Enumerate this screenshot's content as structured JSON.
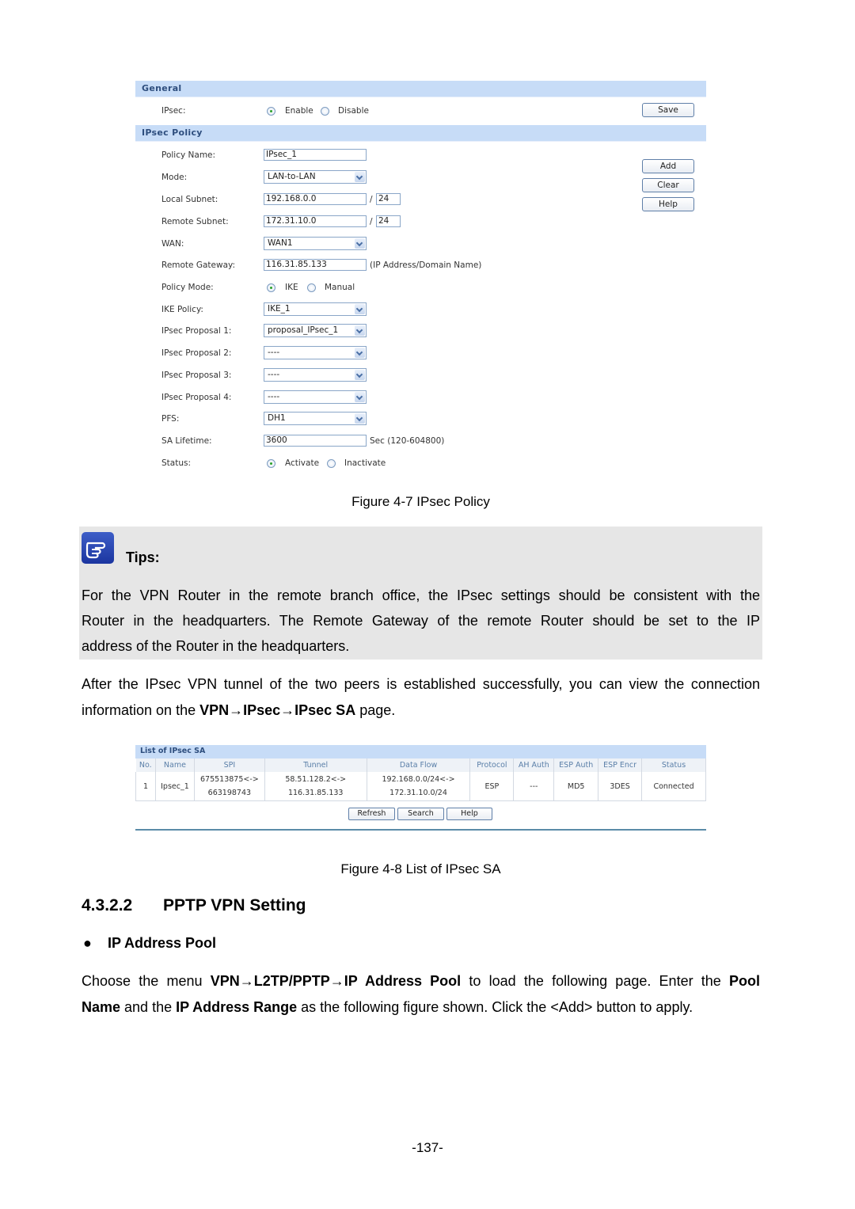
{
  "figure1": {
    "general_header": "General",
    "ipsec_label": "IPsec:",
    "ipsec_options": [
      "Enable",
      "Disable"
    ],
    "ipsec_selected": "Enable",
    "save_label": "Save",
    "policy_header": "IPsec Policy",
    "add_label": "Add",
    "clear_label": "Clear",
    "help_label": "Help",
    "fields": {
      "policy_name": {
        "label": "Policy Name:",
        "value": "IPsec_1"
      },
      "mode": {
        "label": "Mode:",
        "value": "LAN-to-LAN"
      },
      "local_subnet": {
        "label": "Local Subnet:",
        "value": "192.168.0.0",
        "mask": "24"
      },
      "remote_subnet": {
        "label": "Remote Subnet:",
        "value": "172.31.10.0",
        "mask": "24"
      },
      "wan": {
        "label": "WAN:",
        "value": "WAN1"
      },
      "remote_gateway": {
        "label": "Remote Gateway:",
        "value": "116.31.85.133",
        "hint": "(IP Address/Domain Name)"
      },
      "policy_mode": {
        "label": "Policy Mode:",
        "options": [
          "IKE",
          "Manual"
        ],
        "selected": "IKE"
      },
      "ike_policy": {
        "label": "IKE Policy:",
        "value": "IKE_1"
      },
      "proposal1": {
        "label": "IPsec Proposal 1:",
        "value": "proposal_IPsec_1"
      },
      "proposal2": {
        "label": "IPsec Proposal 2:",
        "value": "----"
      },
      "proposal3": {
        "label": "IPsec Proposal 3:",
        "value": "----"
      },
      "proposal4": {
        "label": "IPsec Proposal 4:",
        "value": "----"
      },
      "pfs": {
        "label": "PFS:",
        "value": "DH1"
      },
      "sa_lifetime": {
        "label": "SA Lifetime:",
        "value": "3600",
        "hint": "Sec (120-604800)"
      },
      "status": {
        "label": "Status:",
        "options": [
          "Activate",
          "Inactivate"
        ],
        "selected": "Activate"
      }
    },
    "slash": "/",
    "caption": "Figure 4-7 IPsec Policy"
  },
  "tips": {
    "icon": "pointing-hand-icon",
    "title": "Tips:",
    "lines": [
      "For the VPN Router in the remote branch office, the IPsec settings should be consistent with the",
      "Router in the headquarters. The Remote Gateway of the remote Router should be set to the IP",
      "address of the Router in the headquarters."
    ]
  },
  "para1": {
    "line1": "After the IPsec VPN tunnel of the two peers is established successfully, you can view the connection",
    "line2_pre": "information on the ",
    "line2_bold": "VPN→IPsec→IPsec SA",
    "line2_post": " page."
  },
  "figure2": {
    "header": "List of IPsec SA",
    "columns": [
      "No.",
      "Name",
      "SPI",
      "Tunnel",
      "Data Flow",
      "Protocol",
      "AH Auth",
      "ESP Auth",
      "ESP Encr",
      "Status"
    ],
    "rows": [
      {
        "no": "1",
        "name": "Ipsec_1",
        "spi": [
          "675513875<->",
          "663198743"
        ],
        "tunnel": [
          "58.51.128.2<->",
          "116.31.85.133"
        ],
        "data_flow": [
          "192.168.0.0/24<->",
          "172.31.10.0/24"
        ],
        "protocol": "ESP",
        "ah_auth": "---",
        "esp_auth": "MD5",
        "esp_encr": "3DES",
        "status": "Connected"
      }
    ],
    "buttons": [
      "Refresh",
      "Search",
      "Help"
    ],
    "caption": "Figure 4-8 List of IPsec SA"
  },
  "section": {
    "number": "4.3.2.2",
    "title": "PPTP VPN Setting",
    "bullet": "IP Address Pool"
  },
  "para2": {
    "l1_a": "Choose the menu ",
    "l1_b": "VPN→L2TP/PPTP→IP Address Pool",
    "l1_c": " to load the following page. Enter the ",
    "l1_d": "Pool",
    "l2_a": "Name",
    "l2_b": " and the ",
    "l2_c": "IP Address Range",
    "l2_d": " as the following figure shown. Click the <Add> button to apply."
  },
  "page_number": "-137-"
}
